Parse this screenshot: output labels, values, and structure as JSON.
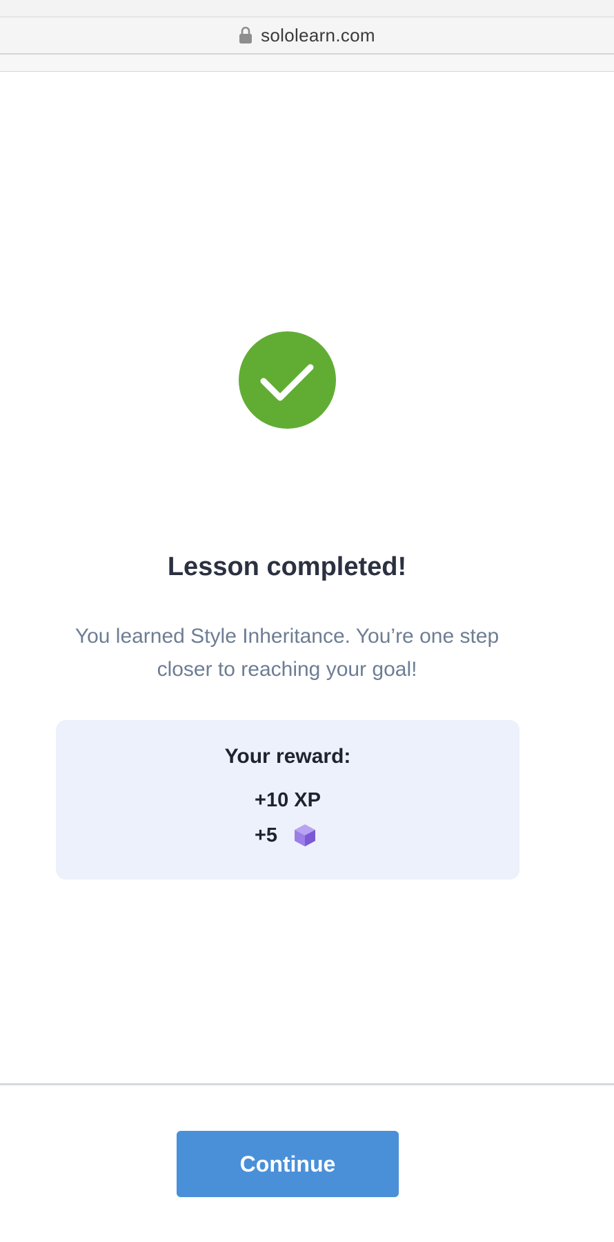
{
  "browser": {
    "url": "sololearn.com",
    "lock_icon": "lock-icon"
  },
  "lesson": {
    "status_icon": "check-icon",
    "status_color": "#61ad34",
    "title": "Lesson completed!",
    "message": "You learned Style Inheritance. You’re one step closer to reaching your goal!"
  },
  "reward": {
    "heading": "Your reward:",
    "xp": "+10 XP",
    "gems": "+5",
    "gem_icon": "gem-icon",
    "gem_color": "#8a6cdc"
  },
  "footer": {
    "continue_label": "Continue",
    "accent": "#4a90d9"
  }
}
